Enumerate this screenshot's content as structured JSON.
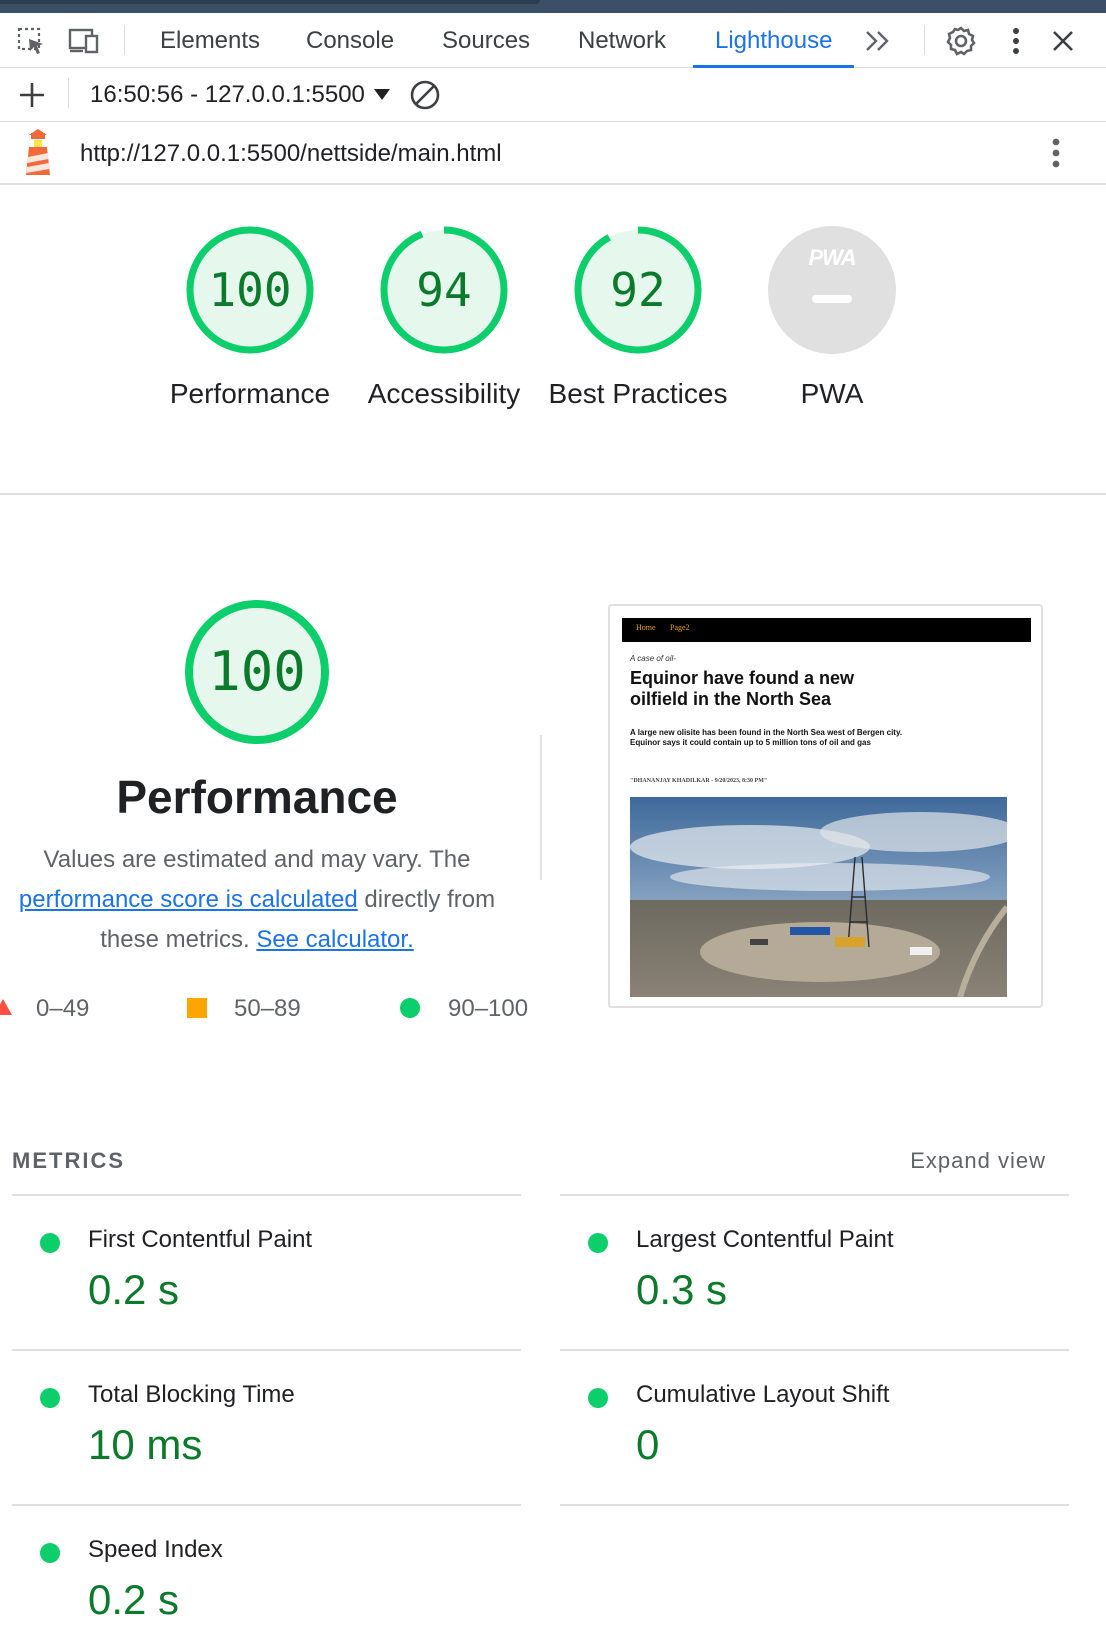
{
  "devtools": {
    "tabs": [
      "Elements",
      "Console",
      "Sources",
      "Network",
      "Lighthouse"
    ],
    "active_tab": "Lighthouse",
    "session": "16:50:56 - 127.0.0.1:5500",
    "url": "http://127.0.0.1:5500/nettside/main.html"
  },
  "categories": [
    {
      "label": "Performance",
      "score": "100",
      "score_value": 100
    },
    {
      "label": "Accessibility",
      "score": "94",
      "score_value": 94
    },
    {
      "label": "Best Practices",
      "score": "92",
      "score_value": 92
    },
    {
      "label": "PWA",
      "score": "",
      "score_value": null
    }
  ],
  "pwa_badge": "PWA",
  "performance": {
    "score": "100",
    "title": "Performance",
    "desc_1": "Values are estimated and may vary. The",
    "link_1": "performance score is calculated",
    "desc_2": " directly from these metrics.",
    "link_2": "See calculator."
  },
  "legend": [
    {
      "range": "0–49",
      "color": "#ff4e42"
    },
    {
      "range": "50–89",
      "color": "#ffa400"
    },
    {
      "range": "90–100",
      "color": "#0cce6b"
    }
  ],
  "thumbnail": {
    "nav": [
      "Home",
      "Page2"
    ],
    "kicker": "A case of oil-",
    "headline": "Equinor have found a new oilfield in the North Sea",
    "body_1": "A large new olisite has been found in the North Sea west of Bergen city.",
    "body_2": "Equinor says it could contain up to 5 million tons of oil and gas",
    "byline": "\"DHANANJAY KHADILKAR - 9/20/2023, 8:30 PM\""
  },
  "metrics": {
    "heading": "METRICS",
    "expand_label": "Expand view",
    "items": [
      {
        "label": "First Contentful Paint",
        "value": "0.2 s"
      },
      {
        "label": "Largest Contentful Paint",
        "value": "0.3 s"
      },
      {
        "label": "Total Blocking Time",
        "value": "10 ms"
      },
      {
        "label": "Cumulative Layout Shift",
        "value": "0"
      },
      {
        "label": "Speed Index",
        "value": "0.2 s"
      }
    ]
  },
  "colors": {
    "pass": "#0cce6b",
    "pass_text": "#0b7a2a",
    "accent": "#1a73e8"
  }
}
